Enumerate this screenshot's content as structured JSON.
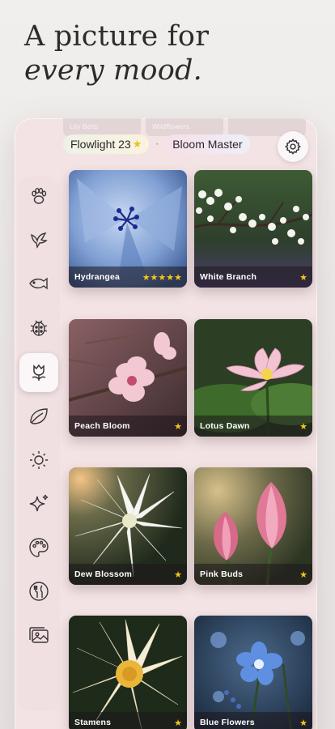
{
  "headline": {
    "line1": "A picture for",
    "line2": "every mood."
  },
  "ghost_tabs": [
    "Lily Bells",
    "Wildflowers",
    ""
  ],
  "chips": {
    "flowlight_label": "Flowlight 23",
    "flowlight_star": "★",
    "separator": "·",
    "bloom_label": "Bloom Master"
  },
  "settings": {
    "icon": "gear-icon"
  },
  "sidebar": {
    "items": [
      {
        "icon": "paw-icon",
        "active": false
      },
      {
        "icon": "bird-icon",
        "active": false
      },
      {
        "icon": "fish-icon",
        "active": false
      },
      {
        "icon": "ladybug-icon",
        "active": false
      },
      {
        "icon": "tulip-icon",
        "active": true
      },
      {
        "icon": "leaf-icon",
        "active": false
      },
      {
        "icon": "sun-icon",
        "active": false
      },
      {
        "icon": "sparkle-icon",
        "active": false
      },
      {
        "icon": "palette-icon",
        "active": false
      },
      {
        "icon": "dining-icon",
        "active": false
      },
      {
        "icon": "gallery-icon",
        "active": false
      }
    ]
  },
  "cards": [
    {
      "title": "Hydrangea",
      "stars": "★★★★★"
    },
    {
      "title": "White Branch",
      "stars": "★"
    },
    {
      "title": "Peach Bloom",
      "stars": "★"
    },
    {
      "title": "Lotus Dawn",
      "stars": "★"
    },
    {
      "title": "Dew Blossom",
      "stars": "★"
    },
    {
      "title": "Pink Buds",
      "stars": "★"
    },
    {
      "title": "Stamens",
      "stars": "★"
    },
    {
      "title": "Blue Flowers",
      "stars": "★"
    }
  ]
}
